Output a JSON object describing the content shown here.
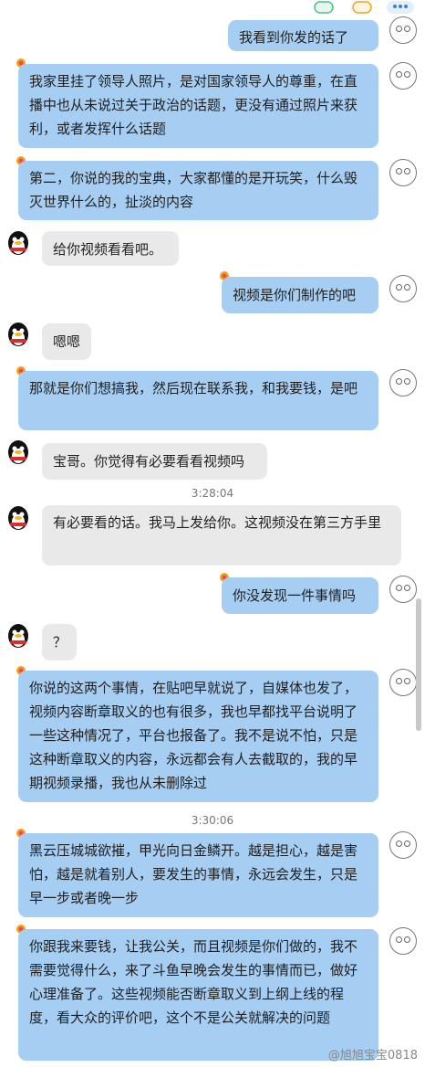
{
  "top_icons": [
    "cloud-badge-icon",
    "cloud-badge-icon",
    "more-icon"
  ],
  "messages": [
    {
      "side": "me",
      "text": "我看到你发的话了"
    },
    {
      "side": "me",
      "text": "我家里挂了领导人照片，是对国家领导人的尊重，在直播中也从未说过关于政治的话题，更没有通过照片来获利，或者发挥什么话题"
    },
    {
      "side": "me",
      "text": "第二，你说的我的宝典，大家都懂的是开玩笑，什么毁灭世界什么的，扯淡的内容"
    },
    {
      "side": "them",
      "text": "给你视频看看吧。"
    },
    {
      "side": "me",
      "text": "视频是你们制作的吧"
    },
    {
      "side": "them",
      "text": "嗯嗯"
    },
    {
      "side": "me",
      "text": "那就是你们想搞我，然后现在联系我，和我要钱，是吧"
    },
    {
      "side": "them",
      "text": "宝哥。你觉得有必要看看视频吗"
    },
    {
      "side": "them",
      "text": "有必要看的话。我马上发给你。这视频没在第三方手里"
    },
    {
      "side": "me",
      "text": "你没发现一件事情吗"
    },
    {
      "side": "them",
      "text": "？"
    },
    {
      "side": "me",
      "text": "你说的这两个事情，在贴吧早就说了，自媒体也发了，视频内容断章取义的也有很多，我也早都找平台说明了一些这种情况了，平台也报备了。我不是说不怕，只是这种断章取义的内容，永远都会有人去截取的，我的早期视频录播，我也从未删除过"
    },
    {
      "side": "me",
      "text": "黑云压城城欲摧，甲光向日金鳞开。越是担心，越是害怕，越是就着别人，要发生的事情，永远会发生，只是早一步或者晚一步"
    },
    {
      "side": "me",
      "text": "你跟我来要钱，让我公关，而且视频是你们做的，我不需要觉得什么，来了斗鱼早晚会发生的事情而已，做好心理准备了。这些视频能否断章取义到上纲上线的程度，看大众的评价吧，这个不是公关就解决的问题"
    }
  ],
  "timestamps": [
    "3:28:04",
    "3:30:06"
  ],
  "watermark": "@旭旭宝宝0818",
  "colors": {
    "me_bubble": "#a6cdf2",
    "them_bubble": "#e9e9e9"
  }
}
